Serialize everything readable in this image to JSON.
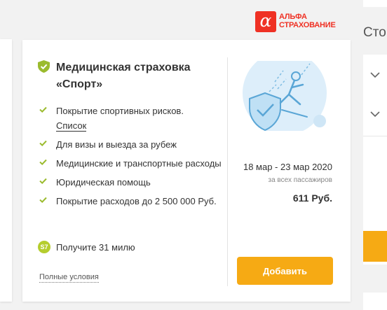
{
  "brand": {
    "badge": "α",
    "line1": "АЛЬФА",
    "line2": "СТРАХОВАНИЕ",
    "color": "#ef3124"
  },
  "offer": {
    "title": "Медицинская страховка «Спорт»",
    "title_icon": "shield-check-icon",
    "features": [
      {
        "text": "Покрытие спортивных рисков.",
        "link": "Список"
      },
      {
        "text": "Для визы и выезда за рубеж"
      },
      {
        "text": "Медицинские и транспортные расходы"
      },
      {
        "text": "Юридическая помощь"
      },
      {
        "text": "Покрытие расходов до 2 500 000 Руб."
      }
    ],
    "miles_badge": "S7",
    "miles_text": "Получите 31 милю",
    "terms_link": "Полные условия",
    "dates": "18 мар - 23 мар 2020",
    "passengers_note": "за всех пассажиров",
    "price": "611 Руб.",
    "add_button": "Добавить",
    "illustration": "skier-shield-icon",
    "accent_color": "#f6aa14",
    "check_color": "#9bbb2e"
  },
  "right_panel": {
    "header": "Сто"
  }
}
